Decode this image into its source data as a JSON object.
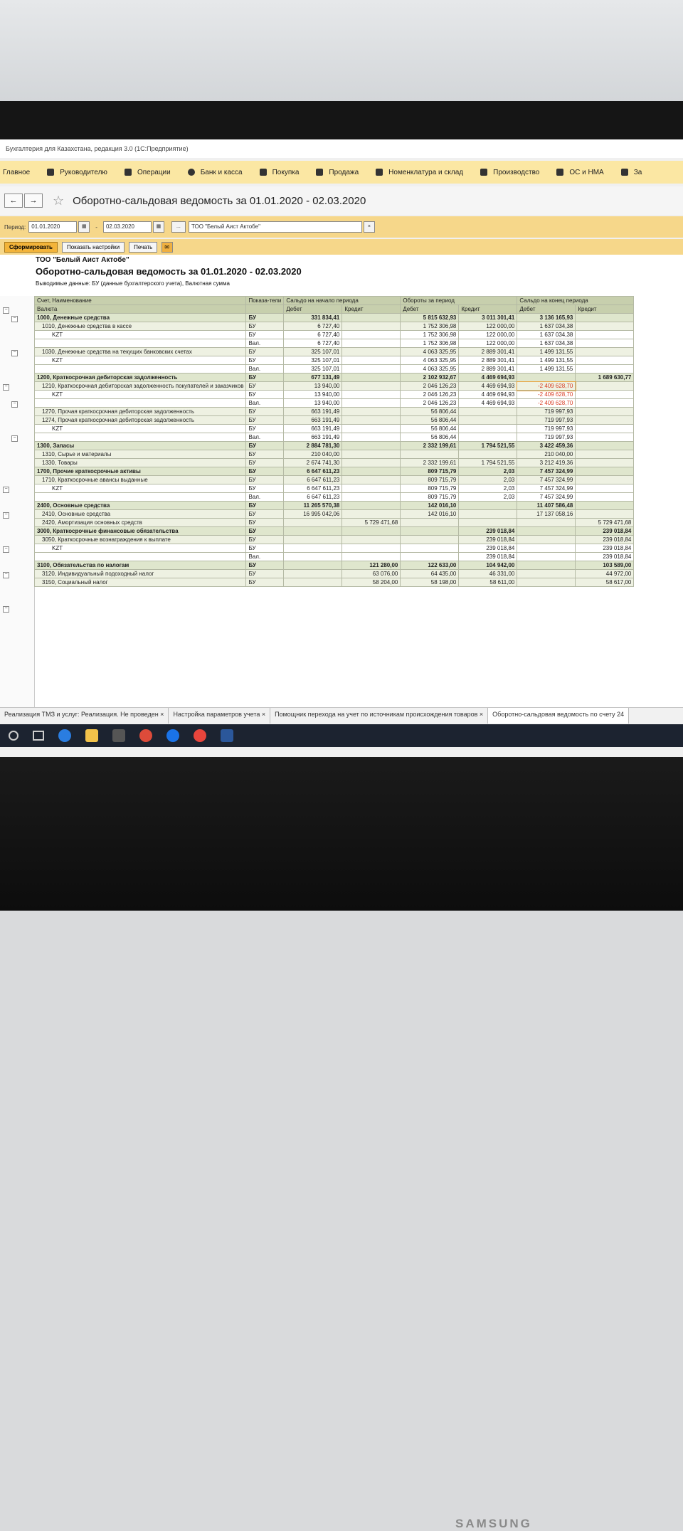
{
  "app_title": "Бухгалтерия для Казахстана, редакция 3.0 (1С:Предприятие)",
  "menu": [
    {
      "label": "Главное",
      "icon": "home-icon"
    },
    {
      "label": "Руководителю",
      "icon": "chart-icon"
    },
    {
      "label": "Операции",
      "icon": "operations-icon"
    },
    {
      "label": "Банк и касса",
      "icon": "bank-icon"
    },
    {
      "label": "Покупка",
      "icon": "cart-icon"
    },
    {
      "label": "Продажа",
      "icon": "bag-icon"
    },
    {
      "label": "Номенклатура и склад",
      "icon": "grid-icon"
    },
    {
      "label": "Производство",
      "icon": "factory-icon"
    },
    {
      "label": "ОС и НМА",
      "icon": "truck-icon"
    },
    {
      "label": "За",
      "icon": "folder-icon"
    }
  ],
  "page_title": "Оборотно-сальдовая ведомость  за 01.01.2020 - 02.03.2020",
  "filter": {
    "period_label": "Период:",
    "date_from": "01.01.2020",
    "dash": "-",
    "date_to": "02.03.2020",
    "ellipsis": "...",
    "organization": "ТОО \"Белый Аист Актобе\"",
    "clear": "×"
  },
  "buttons": {
    "generate": "Сформировать",
    "show_settings": "Показать настройки",
    "print": "Печать"
  },
  "report": {
    "org": "ТОО \"Белый Аист Актобе\"",
    "title": "Оборотно-сальдовая ведомость  за 01.01.2020 - 02.03.2020",
    "note": "Выводимые данные:  БУ (данные бухгалтерского учета), Валютная сумма",
    "headers": {
      "account": "Счет, Наименование",
      "currency": "Валюта",
      "indicators": "Показа-тели",
      "opening": "Сальдо на начало периода",
      "turnover": "Обороты за период",
      "closing": "Сальдо на конец периода",
      "debit": "Дебет",
      "credit": "Кредит"
    },
    "rows": [
      {
        "level": "l1",
        "name": "1000, Денежные средства",
        "ind": "БУ",
        "c": [
          "331 834,41",
          "",
          "5 815 632,93",
          "3 011 301,41",
          "3 136 165,93",
          ""
        ]
      },
      {
        "level": "l2",
        "name": "1010, Денежные средства в кассе",
        "ind": "БУ",
        "c": [
          "6 727,40",
          "",
          "1 752 306,98",
          "122 000,00",
          "1 637 034,38",
          ""
        ]
      },
      {
        "level": "l3",
        "name": "KZT",
        "ind": "БУ",
        "c": [
          "6 727,40",
          "",
          "1 752 306,98",
          "122 000,00",
          "1 637 034,38",
          ""
        ]
      },
      {
        "level": "l3",
        "name": "",
        "ind": "Вал.",
        "c": [
          "6 727,40",
          "",
          "1 752 306,98",
          "122 000,00",
          "1 637 034,38",
          ""
        ]
      },
      {
        "level": "l2",
        "name": "1030, Денежные средства на текущих банковских счетах",
        "ind": "БУ",
        "c": [
          "325 107,01",
          "",
          "4 063 325,95",
          "2 889 301,41",
          "1 499 131,55",
          ""
        ]
      },
      {
        "level": "l3",
        "name": "KZT",
        "ind": "БУ",
        "c": [
          "325 107,01",
          "",
          "4 063 325,95",
          "2 889 301,41",
          "1 499 131,55",
          ""
        ]
      },
      {
        "level": "l3",
        "name": "",
        "ind": "Вал.",
        "c": [
          "325 107,01",
          "",
          "4 063 325,95",
          "2 889 301,41",
          "1 499 131,55",
          ""
        ]
      },
      {
        "level": "l1",
        "name": "1200, Краткосрочная дебиторская задолженность",
        "ind": "БУ",
        "c": [
          "677 131,49",
          "",
          "2 102 932,67",
          "4 469 694,93",
          "",
          "1 689 630,77"
        ]
      },
      {
        "level": "l2",
        "name": "1210, Краткосрочная дебиторская задолженность покупателей и заказчиков",
        "ind": "БУ",
        "c": [
          "13 940,00",
          "",
          "2 046 126,23",
          "4 469 694,93",
          "-2 409 628,70",
          ""
        ]
      },
      {
        "level": "l3",
        "name": "KZT",
        "ind": "БУ",
        "c": [
          "13 940,00",
          "",
          "2 046 126,23",
          "4 469 694,93",
          "-2 409 628,70",
          ""
        ]
      },
      {
        "level": "l3",
        "name": "",
        "ind": "Вал.",
        "c": [
          "13 940,00",
          "",
          "2 046 126,23",
          "4 469 694,93",
          "-2 409 628,70",
          ""
        ]
      },
      {
        "level": "l2",
        "name": "1270, Прочая краткосрочная дебиторская задолженность",
        "ind": "БУ",
        "c": [
          "663 191,49",
          "",
          "56 806,44",
          "",
          "719 997,93",
          ""
        ]
      },
      {
        "level": "l2",
        "name": "1274, Прочая краткосрочная дебиторская задолженность",
        "ind": "БУ",
        "c": [
          "663 191,49",
          "",
          "56 806,44",
          "",
          "719 997,93",
          ""
        ]
      },
      {
        "level": "l3",
        "name": "KZT",
        "ind": "БУ",
        "c": [
          "663 191,49",
          "",
          "56 806,44",
          "",
          "719 997,93",
          ""
        ]
      },
      {
        "level": "l3",
        "name": "",
        "ind": "Вал.",
        "c": [
          "663 191,49",
          "",
          "56 806,44",
          "",
          "719 997,93",
          ""
        ]
      },
      {
        "level": "l1",
        "name": "1300, Запасы",
        "ind": "БУ",
        "c": [
          "2 884 781,30",
          "",
          "2 332 199,61",
          "1 794 521,55",
          "3 422 459,36",
          ""
        ]
      },
      {
        "level": "l2",
        "name": "1310, Сырье и материалы",
        "ind": "БУ",
        "c": [
          "210 040,00",
          "",
          "",
          "",
          "210 040,00",
          ""
        ]
      },
      {
        "level": "l2",
        "name": "1330, Товары",
        "ind": "БУ",
        "c": [
          "2 674 741,30",
          "",
          "2 332 199,61",
          "1 794 521,55",
          "3 212 419,36",
          ""
        ]
      },
      {
        "level": "l1",
        "name": "1700, Прочие краткосрочные активы",
        "ind": "БУ",
        "c": [
          "6 647 611,23",
          "",
          "809 715,79",
          "2,03",
          "7 457 324,99",
          ""
        ]
      },
      {
        "level": "l2",
        "name": "1710, Краткосрочные авансы выданные",
        "ind": "БУ",
        "c": [
          "6 647 611,23",
          "",
          "809 715,79",
          "2,03",
          "7 457 324,99",
          ""
        ]
      },
      {
        "level": "l3",
        "name": "KZT",
        "ind": "БУ",
        "c": [
          "6 647 611,23",
          "",
          "809 715,79",
          "2,03",
          "7 457 324,99",
          ""
        ]
      },
      {
        "level": "l3",
        "name": "",
        "ind": "Вал.",
        "c": [
          "6 647 611,23",
          "",
          "809 715,79",
          "2,03",
          "7 457 324,99",
          ""
        ]
      },
      {
        "level": "l1",
        "name": "2400, Основные средства",
        "ind": "БУ",
        "c": [
          "11 265 570,38",
          "",
          "142 016,10",
          "",
          "11 407 586,48",
          ""
        ]
      },
      {
        "level": "l2",
        "name": "2410, Основные средства",
        "ind": "БУ",
        "c": [
          "16 995 042,06",
          "",
          "142 016,10",
          "",
          "17 137 058,16",
          ""
        ]
      },
      {
        "level": "l2",
        "name": "2420, Амортизация основных средств",
        "ind": "БУ",
        "c": [
          "",
          "5 729 471,68",
          "",
          "",
          "",
          "5 729 471,68"
        ]
      },
      {
        "level": "l1",
        "name": "3000, Краткосрочные финансовые обязательства",
        "ind": "БУ",
        "c": [
          "",
          "",
          "",
          "239 018,84",
          "",
          "239 018,84"
        ]
      },
      {
        "level": "l2",
        "name": "3050, Краткосрочные вознаграждения к выплате",
        "ind": "БУ",
        "c": [
          "",
          "",
          "",
          "239 018,84",
          "",
          "239 018,84"
        ]
      },
      {
        "level": "l3",
        "name": "KZT",
        "ind": "БУ",
        "c": [
          "",
          "",
          "",
          "239 018,84",
          "",
          "239 018,84"
        ]
      },
      {
        "level": "l3",
        "name": "",
        "ind": "Вал.",
        "c": [
          "",
          "",
          "",
          "239 018,84",
          "",
          "239 018,84"
        ]
      },
      {
        "level": "l1",
        "name": "3100, Обязательства по налогам",
        "ind": "БУ",
        "c": [
          "",
          "121 280,00",
          "122 633,00",
          "104 942,00",
          "",
          "103 589,00"
        ]
      },
      {
        "level": "l2",
        "name": "3120, Индивидуальный подоходный налог",
        "ind": "БУ",
        "c": [
          "",
          "63 076,00",
          "64 435,00",
          "46 331,00",
          "",
          "44 972,00"
        ]
      },
      {
        "level": "l2",
        "name": "3150, Социальный налог",
        "ind": "БУ",
        "c": [
          "",
          "58 204,00",
          "58 198,00",
          "58 611,00",
          "",
          "58 617,00"
        ]
      }
    ]
  },
  "open_tabs": [
    "Реализация ТМЗ и услуг: Реализация. Не проведен ×",
    "Настройка параметров учета ×",
    "Помощник перехода на учет по источникам происхождения товаров ×",
    "Оборотно-сальдовая ведомость по счету 24"
  ],
  "monitor_brand": "SAMSUNG"
}
